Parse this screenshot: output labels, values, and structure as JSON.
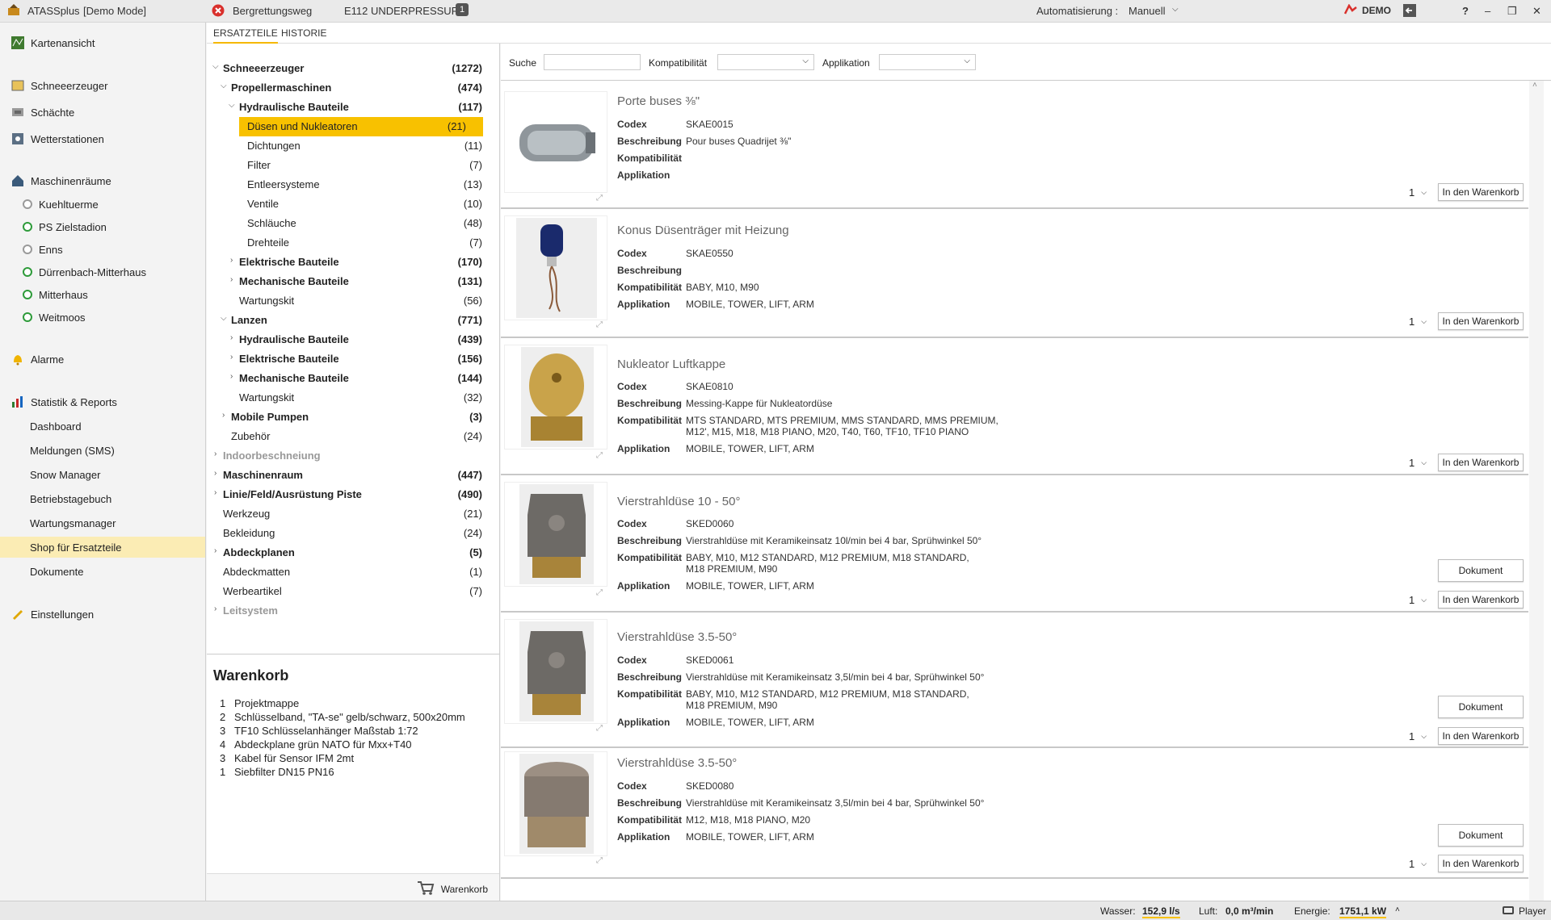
{
  "titlebar": {
    "app": "ATASSplus",
    "mode": "[Demo Mode]",
    "location": "Bergrettungsweg",
    "alert": "E112 UNDERPRESSURE",
    "alert_count": "1",
    "auto_label": "Automatisierung :",
    "auto_value": "Manuell",
    "user": "DEMO",
    "help": "?",
    "min": "–",
    "restore": "❐",
    "close": "✕"
  },
  "nav": {
    "items": [
      {
        "label": "Kartenansicht",
        "icon": "map-icon"
      },
      {
        "label": "Schneeerzeuger",
        "icon": "snowmaker-icon"
      },
      {
        "label": "Schächte",
        "icon": "shaft-icon"
      },
      {
        "label": "Wetterstationen",
        "icon": "weather-icon"
      },
      {
        "label": "Maschinenräume",
        "icon": "machine-room-icon"
      },
      {
        "label": "Kuehltuerme",
        "icon": "status-dot-icon"
      },
      {
        "label": "PS Zielstadion",
        "icon": "status-dot-icon"
      },
      {
        "label": "Enns",
        "icon": "status-dot-icon"
      },
      {
        "label": "Dürrenbach-Mitterhaus",
        "icon": "status-dot-icon"
      },
      {
        "label": "Mitterhaus",
        "icon": "status-dot-icon"
      },
      {
        "label": "Weitmoos",
        "icon": "status-dot-icon"
      },
      {
        "label": "Alarme",
        "icon": "bell-icon"
      },
      {
        "label": "Statistik & Reports",
        "icon": "chart-icon"
      },
      {
        "label": "Dashboard"
      },
      {
        "label": "Meldungen (SMS)"
      },
      {
        "label": "Snow Manager"
      },
      {
        "label": "Betriebstagebuch"
      },
      {
        "label": "Wartungsmanager"
      },
      {
        "label": "Shop für Ersatzteile"
      },
      {
        "label": "Dokumente"
      },
      {
        "label": "Einstellungen",
        "icon": "settings-icon"
      }
    ]
  },
  "tabs": [
    "ERSATZTEILE",
    "HISTORIE"
  ],
  "tree": [
    {
      "label": "Schneeerzeuger",
      "count": "(1272)"
    },
    {
      "label": "Propellermaschinen",
      "count": "(474)"
    },
    {
      "label": "Hydraulische Bauteile",
      "count": "(117)"
    },
    {
      "label": "Düsen und Nukleatoren",
      "count": "(21)"
    },
    {
      "label": "Dichtungen",
      "count": "(11)"
    },
    {
      "label": "Filter",
      "count": "(7)"
    },
    {
      "label": "Entleersysteme",
      "count": "(13)"
    },
    {
      "label": "Ventile",
      "count": "(10)"
    },
    {
      "label": "Schläuche",
      "count": "(48)"
    },
    {
      "label": "Drehteile",
      "count": "(7)"
    },
    {
      "label": "Elektrische Bauteile",
      "count": "(170)"
    },
    {
      "label": "Mechanische Bauteile",
      "count": "(131)"
    },
    {
      "label": "Wartungskit",
      "count": "(56)"
    },
    {
      "label": "Lanzen",
      "count": "(771)"
    },
    {
      "label": "Hydraulische Bauteile",
      "count": "(439)"
    },
    {
      "label": "Elektrische Bauteile",
      "count": "(156)"
    },
    {
      "label": "Mechanische Bauteile",
      "count": "(144)"
    },
    {
      "label": "Wartungskit",
      "count": "(32)"
    },
    {
      "label": "Mobile Pumpen",
      "count": "(3)"
    },
    {
      "label": "Zubehör",
      "count": "(24)"
    },
    {
      "label": "Indoorbeschneiung",
      "count": ""
    },
    {
      "label": "Maschinenraum",
      "count": "(447)"
    },
    {
      "label": "Linie/Feld/Ausrüstung Piste",
      "count": "(490)"
    },
    {
      "label": "Werkzeug",
      "count": "(21)"
    },
    {
      "label": "Bekleidung",
      "count": "(24)"
    },
    {
      "label": "Abdeckplanen",
      "count": "(5)"
    },
    {
      "label": "Abdeckmatten",
      "count": "(1)"
    },
    {
      "label": "Werbeartikel",
      "count": "(7)"
    },
    {
      "label": "Leitsystem",
      "count": ""
    }
  ],
  "cart": {
    "title": "Warenkorb",
    "items": [
      {
        "q": "1",
        "name": "Projektmappe"
      },
      {
        "q": "2",
        "name": "Schlüsselband, \"TA-se\" gelb/schwarz, 500x20mm"
      },
      {
        "q": "3",
        "name": "TF10 Schlüsselanhänger Maßstab 1:72"
      },
      {
        "q": "4",
        "name": "Abdeckplane grün NATO für Mxx+T40"
      },
      {
        "q": "3",
        "name": "Kabel für Sensor IFM 2mt"
      },
      {
        "q": "1",
        "name": "Siebfilter DN15 PN16"
      }
    ],
    "button": "Warenkorb"
  },
  "filter": {
    "search_label": "Suche",
    "compat_label": "Kompatibilität",
    "app_label": "Applikation"
  },
  "labels": {
    "codex": "Codex",
    "desc": "Beschreibung",
    "compat": "Kompatibilität",
    "app": "Applikation",
    "add": "In den Warenkorb",
    "doc": "Dokument"
  },
  "products": [
    {
      "title": "Porte buses ⅜\"",
      "codex": "SKAE0015",
      "desc": "Pour buses Quadrijet ⅜\"",
      "compat": "",
      "app": "",
      "qty": "1",
      "doc": false
    },
    {
      "title": "Konus Düsenträger mit Heizung",
      "codex": "SKAE0550",
      "desc": "",
      "compat": "BABY, M10, M90",
      "app": "MOBILE, TOWER, LIFT, ARM",
      "qty": "1",
      "doc": false
    },
    {
      "title": "Nukleator Luftkappe",
      "codex": "SKAE0810",
      "desc": "Messing-Kappe für Nukleatordüse",
      "compat": "MTS STANDARD, MTS PREMIUM, MMS STANDARD, MMS PREMIUM, M12', M15, M18, M18 PIANO, M20, T40, T60, TF10, TF10 PIANO",
      "app": "MOBILE, TOWER, LIFT, ARM",
      "qty": "1",
      "doc": false
    },
    {
      "title": "Vierstrahldüse 10 - 50°",
      "codex": "SKED0060",
      "desc": "Vierstrahldüse mit Keramikeinsatz 10l/min bei 4 bar, Sprühwinkel 50°",
      "compat": "BABY, M10, M12 STANDARD, M12 PREMIUM, M18 STANDARD, M18 PREMIUM, M90",
      "app": "MOBILE, TOWER, LIFT, ARM",
      "qty": "1",
      "doc": true
    },
    {
      "title": "Vierstrahldüse 3.5-50°",
      "codex": "SKED0061",
      "desc": "Vierstrahldüse mit Keramikeinsatz 3,5l/min bei 4 bar, Sprühwinkel 50°",
      "compat": "BABY, M10, M12 STANDARD, M12 PREMIUM, M18 STANDARD, M18 PREMIUM, M90",
      "app": "MOBILE, TOWER, LIFT, ARM",
      "qty": "1",
      "doc": true
    },
    {
      "title": "Vierstrahldüse 3.5-50°",
      "codex": "SKED0080",
      "desc": "Vierstrahldüse mit Keramikeinsatz 3,5l/min bei 4 bar, Sprühwinkel 50°",
      "compat": "M12, M18, M18 PIANO, M20",
      "app": "MOBILE, TOWER, LIFT, ARM",
      "qty": "1",
      "doc": true
    }
  ],
  "status": {
    "water_label": "Wasser:",
    "water": "152,9 l/s",
    "air_label": "Luft:",
    "air": "0,0 m³/min",
    "energy_label": "Energie:",
    "energy": "1751,1 kW",
    "player": "Player"
  },
  "colors": {
    "accent": "#f8c100",
    "selected_nav": "#fbecb4",
    "ok": "#2e9b3a",
    "error": "#d9302c"
  }
}
